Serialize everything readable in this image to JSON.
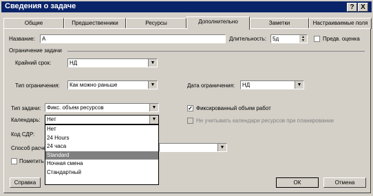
{
  "window": {
    "title": "Сведения о задаче",
    "help_glyph": "?",
    "close_glyph": "X"
  },
  "tabs": [
    {
      "label": "Общие"
    },
    {
      "label": "Предшественники"
    },
    {
      "label": "Ресурсы"
    },
    {
      "label": "Дополнительно",
      "active": true
    },
    {
      "label": "Заметки"
    },
    {
      "label": "Настраиваемые поля"
    }
  ],
  "form": {
    "name_label": "Название:",
    "name_value": "А",
    "duration_label": "Длительность:",
    "duration_value": "5д",
    "estimate_label": "Предв. оценка",
    "constraint_group_label": "Ограничение задачи",
    "deadline_label": "Крайний срок:",
    "deadline_value": "НД",
    "constraint_type_label": "Тип ограничения:",
    "constraint_type_value": "Как можно раньше",
    "constraint_date_label": "Дата ограничения:",
    "constraint_date_value": "НД",
    "task_type_label": "Тип задачи:",
    "task_type_value": "Фикс. объем ресурсов",
    "effort_driven_label": "Фиксированный объем работ",
    "effort_driven_checked": true,
    "calendar_label": "Календарь:",
    "calendar_value": "Нет",
    "ignore_resource_calendars_label": "Не учитывать календари ресурсов при планировании",
    "wbs_label": "Код СДР:",
    "earned_value_label": "Способ расчета",
    "mark_milestone_label": "Пометить"
  },
  "calendar_options": [
    "Нет",
    "24 Hours",
    "24 часа",
    "Standard",
    "Ночная смена",
    "Стандартный"
  ],
  "calendar_highlighted": "Standard",
  "buttons": {
    "help": "Справка",
    "ok": "ОК",
    "cancel": "Отмена"
  },
  "colors": {
    "titlebar": "#0a246a",
    "face": "#d4d0c8",
    "highlight": "#808080"
  }
}
